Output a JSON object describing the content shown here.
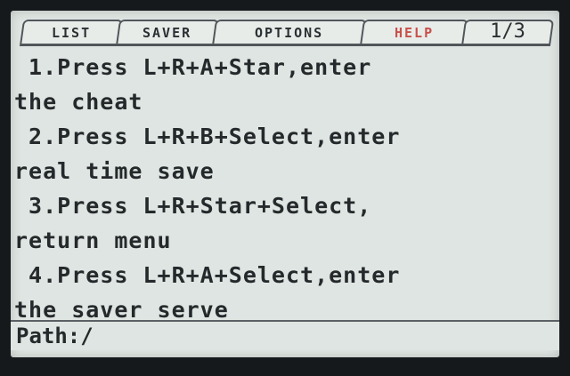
{
  "tabs": [
    {
      "label": "LIST"
    },
    {
      "label": "SAVER"
    },
    {
      "label": "OPTIONS"
    },
    {
      "label": "HELP"
    },
    {
      "label": "1/3"
    }
  ],
  "content": {
    "lines": [
      " 1.Press L+R+A+Star,enter",
      "the cheat",
      " 2.Press L+R+B+Select,enter",
      "real time save",
      " 3.Press L+R+Star+Select,",
      "return menu",
      " 4.Press L+R+A+Select,enter",
      "the saver serve"
    ]
  },
  "footer": {
    "path": "Path:/"
  },
  "colors": {
    "screen_background": "#dfe5e2",
    "text": "#25292b",
    "help_tab_text": "#c8504a",
    "border": "#50565a"
  }
}
